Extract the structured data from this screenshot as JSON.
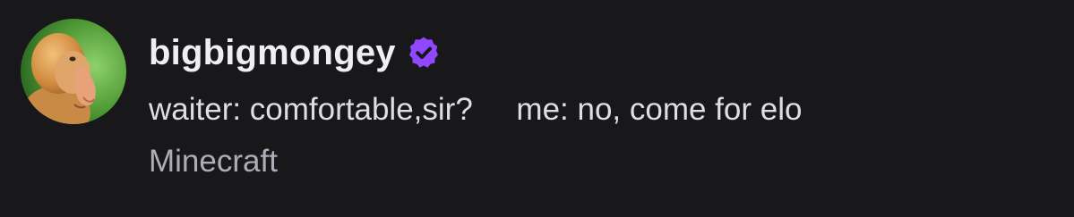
{
  "post": {
    "username": "bigbigmongey",
    "message": "waiter: comfortable,sir?     me: no, come for elo",
    "category": "Minecraft"
  },
  "avatar": {
    "description_icon": "proboscis-monkey-avatar"
  },
  "badge": {
    "icon": "verified-badge-icon",
    "color": "#9147ff"
  },
  "colors": {
    "background": "#18181b",
    "username": "#efeff1",
    "message": "#dedee3",
    "category": "#adadb8"
  }
}
